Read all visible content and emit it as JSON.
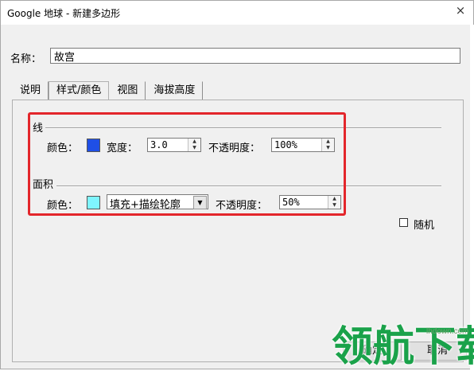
{
  "window": {
    "title": "Google 地球 - 新建多边形",
    "close_glyph": "×"
  },
  "name": {
    "label": "名称：",
    "value": "故宫"
  },
  "tabs": [
    {
      "label": "说明",
      "active": false
    },
    {
      "label": "样式/颜色",
      "active": true
    },
    {
      "label": "视图",
      "active": false
    },
    {
      "label": "海拔高度",
      "active": false
    }
  ],
  "line_section": {
    "heading": "线",
    "color_label": "颜色：",
    "color": "#1f4fe6",
    "width_label": "宽度：",
    "width_value": "3.0",
    "opacity_label": "不透明度：",
    "opacity_value": "100%"
  },
  "area_section": {
    "heading": "面积",
    "color_label": "颜色：",
    "color": "#7ff5ff",
    "fill_mode_value": "填充+描绘轮廓",
    "opacity_label": "不透明度：",
    "opacity_value": "50%"
  },
  "random": {
    "label": "随机",
    "checked": false
  },
  "buttons": {
    "ok": "确定",
    "cancel": "取消"
  },
  "watermark": {
    "text": "领航下载",
    "url": "lhdown.com"
  },
  "colors": {
    "highlight_box": "#e3262b",
    "watermark": "#1aa24a"
  }
}
